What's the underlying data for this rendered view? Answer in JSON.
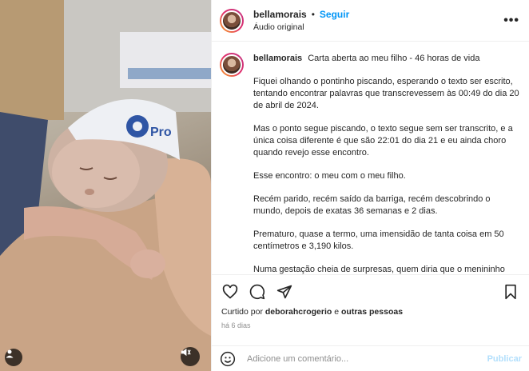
{
  "post": {
    "username": "bellamorais",
    "separator": "•",
    "follow_label": "Seguir",
    "audio_label": "Áudio original",
    "more_icon": "more-horizontal-icon"
  },
  "caption": {
    "username": "bellamorais",
    "title": "Carta aberta ao meu filho - 46 horas de vida",
    "paragraphs": [
      "Fiquei olhando o pontinho piscando, esperando o texto ser escrito, tentando encontrar palavras que transcrevessem às 00:49 do dia 20 de abril de 2024.",
      "Mas o ponto segue piscando, o texto segue sem ser transcrito, e a única coisa diferente é que são 22:01 do dia 21 e eu ainda choro quando revejo esse encontro.",
      "Esse encontro: o meu com o meu filho.",
      "Recém parido, recém saído da barriga, recém descobrindo o mundo, depois de exatas 36 semanas e 2 dias.",
      "Prematuro, quase a termo, uma imensidão de tanta coisa em 50 centímetros e 3,190 kilos.",
      "Numa gestação cheia de surpresas, quem diria que o menininho"
    ]
  },
  "media": {
    "hat_text": "Pro"
  },
  "likes": {
    "prefix": "Curtido por",
    "user": "deborahcrogerio",
    "conj": "e",
    "others": "outras pessoas"
  },
  "time_ago": "há 6 dias",
  "comment": {
    "placeholder": "Adicione um comentário...",
    "publish_label": "Publicar"
  },
  "colors": {
    "accent": "#0095f6",
    "publish_disabled": "#b2dffc"
  }
}
